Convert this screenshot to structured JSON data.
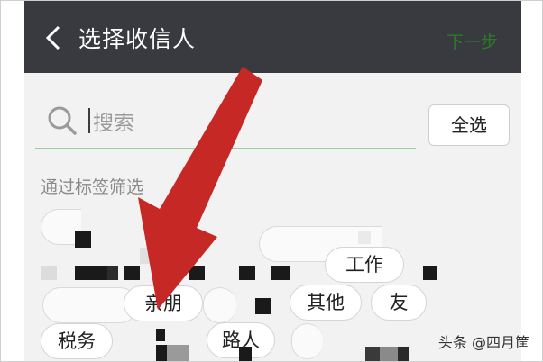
{
  "header": {
    "title": "选择收信人",
    "next_label": "下一步"
  },
  "search": {
    "placeholder": "搜索"
  },
  "select_all_label": "全选",
  "filter_label": "通过标签筛选",
  "tags": [
    {
      "label": "工作"
    },
    {
      "label": "亲朋"
    },
    {
      "label": "其他"
    },
    {
      "label": "友"
    },
    {
      "label": "税务"
    },
    {
      "label": "路人"
    }
  ],
  "watermark": "头条 @四月筐",
  "colors": {
    "topbar": "#393a3f",
    "accent_green": "#2a7a2a",
    "arrow": "#c62825"
  },
  "icons": {
    "back": "chevron-left-icon",
    "search": "search-icon"
  }
}
